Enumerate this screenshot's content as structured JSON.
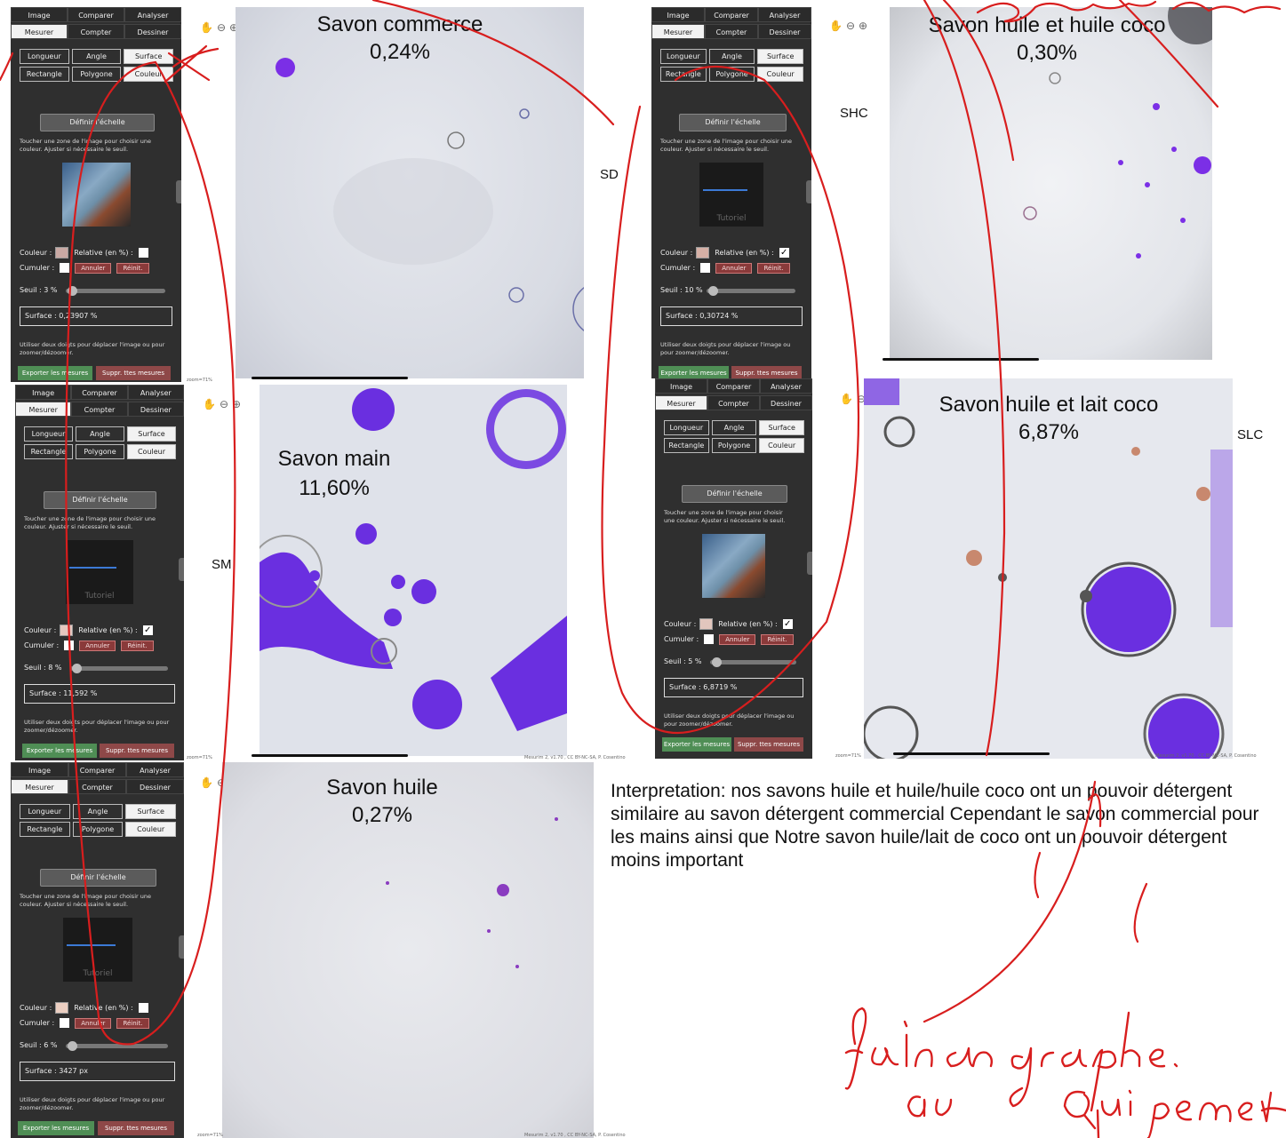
{
  "panel_ui": {
    "tabs_row1": [
      "Image",
      "Comparer",
      "Analyser"
    ],
    "tabs_row2": [
      "Mesurer",
      "Compter",
      "Dessiner"
    ],
    "tools_row1": [
      "Longueur",
      "Angle",
      "Surface"
    ],
    "tools_row2": [
      "Rectangle",
      "Polygone",
      "Couleur"
    ],
    "define_scale": "Définir l'échelle",
    "hint": "Toucher une zone de l'image pour choisir une couleur. Ajuster si nécessaire le seuil.",
    "color_label": "Couleur :",
    "relative_label": "Relative (en %) :",
    "cumulate_label": "Cumuler :",
    "cancel": "Annuler",
    "reset": "Réinit.",
    "tutorial": "Tutoriel",
    "gesture_hint": "Utiliser deux doigts pour déplacer l'image ou pour zoomer/dézoomer.",
    "export": "Exporter les mesures",
    "delete": "Suppr. ttes mesures",
    "footer": "Mesurim 2, v1.70 , CC BY-NC-SA, P. Cosentino",
    "zoom": "zoom=71%"
  },
  "panels": [
    {
      "seuil": "Seuil : 3 %",
      "surface": "Surface : 0,23907 %",
      "swatch": "#c9a9a4",
      "relative_checked": false
    },
    {
      "seuil": "Seuil : 10 %",
      "surface": "Surface : 0,30724 %",
      "swatch": "#d6b0a6",
      "relative_checked": true
    },
    {
      "seuil": "Seuil : 8 %",
      "surface": "Surface : 11,592 %",
      "swatch": "#e6c8c0",
      "relative_checked": true
    },
    {
      "seuil": "Seuil : 5 %",
      "surface": "Surface : 6,8719 %",
      "swatch": "#e2c6bd",
      "relative_checked": true
    },
    {
      "seuil": "Seuil : 6 %",
      "surface": "Surface : 3427 px",
      "swatch": "#eccfc2",
      "relative_checked": false
    }
  ],
  "samples": [
    {
      "name": "Savon commerce",
      "pct": "0,24%",
      "code": "SD"
    },
    {
      "name": "Savon huile et huile coco",
      "pct": "0,30%",
      "code": "SHC"
    },
    {
      "name": "Savon main",
      "pct": "11,60%",
      "code": "SM"
    },
    {
      "name": "Savon huile et lait coco",
      "pct": "6,87%",
      "code": "SLC"
    },
    {
      "name": "Savon huile",
      "pct": "0,27%",
      "code": ""
    }
  ],
  "interpretation": "Interpretation: nos savons huile et huile/huile coco ont un pouvoir détergent similaire au savon détergent commercial Cependant le savon commercial pour les mains ainsi que Notre savon huile/lait de coco ont un pouvoir détergent moins important",
  "handwritten_note": "faire un graphe. Qui permet de comparer",
  "colors": {
    "ink": "#d81e1e",
    "mask": "#6a2fe0",
    "panel": "#2f2f2f"
  }
}
